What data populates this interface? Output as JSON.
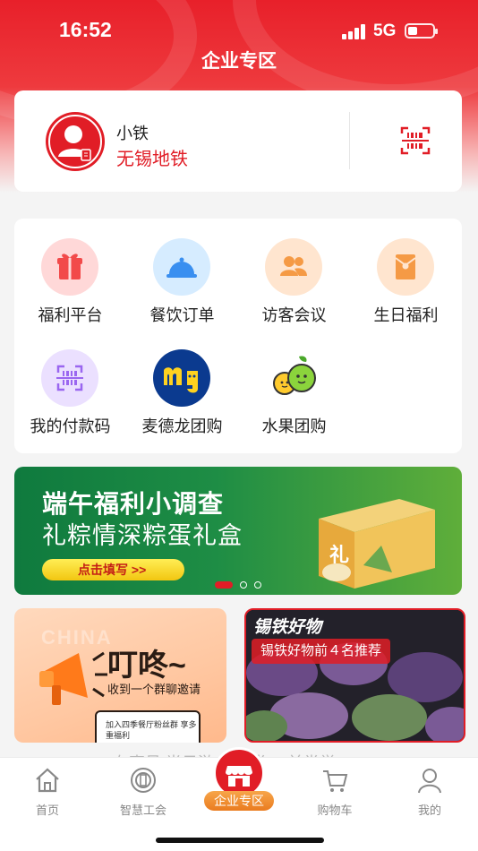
{
  "status_bar": {
    "time": "16:52",
    "network": "5G"
  },
  "header": {
    "title": "企业专区"
  },
  "profile": {
    "name": "小铁",
    "organization": "无锡地铁"
  },
  "services": [
    {
      "label": "福利平台",
      "icon": "gift-icon",
      "bg": "#ffd8d8",
      "fg": "#f24a4a"
    },
    {
      "label": "餐饮订单",
      "icon": "food-cloche-icon",
      "bg": "#d6ecff",
      "fg": "#3a8ff0"
    },
    {
      "label": "访客会议",
      "icon": "people-icon",
      "bg": "#ffe5cf",
      "fg": "#f59a45"
    },
    {
      "label": "生日福利",
      "icon": "red-envelope-icon",
      "bg": "#ffe5cf",
      "fg": "#f59a45"
    },
    {
      "label": "我的付款码",
      "icon": "pay-code-icon",
      "bg": "#ebe0ff",
      "fg": "#9a66f0"
    },
    {
      "label": "麦德龙团购",
      "icon": "metro-logo-icon",
      "bg": "#0b3a8f",
      "fg": "#ffd21f"
    },
    {
      "label": "水果团购",
      "icon": "fruit-icon",
      "bg": "#ffffff",
      "fg": "#6cc62f"
    }
  ],
  "banner": {
    "title": "端午福利小调查",
    "subtitle": "礼粽情深粽蛋礼盒",
    "button": "点击填写 >>"
  },
  "promos": {
    "left": {
      "headline": "叮咚~",
      "subline": "收到一个群聊邀请",
      "watermark": "CHINA",
      "card_text": "加入四季餐厅粉丝群 享多重福利"
    },
    "right": {
      "tag": "锡铁好物",
      "pill": "锡铁好物前４名推荐"
    }
  },
  "ghost_text": "有声号  半日游一 全党 一前党学",
  "tabbar": {
    "items": [
      {
        "label": "首页",
        "icon": "home-icon"
      },
      {
        "label": "智慧工会",
        "icon": "union-emblem-icon"
      },
      {
        "label": "企业专区",
        "icon": "shop-icon"
      },
      {
        "label": "购物车",
        "icon": "cart-icon"
      },
      {
        "label": "我的",
        "icon": "user-icon"
      }
    ]
  },
  "colors": {
    "brand_red": "#e11d26",
    "tab_active_orange": "#ea7b1f"
  }
}
